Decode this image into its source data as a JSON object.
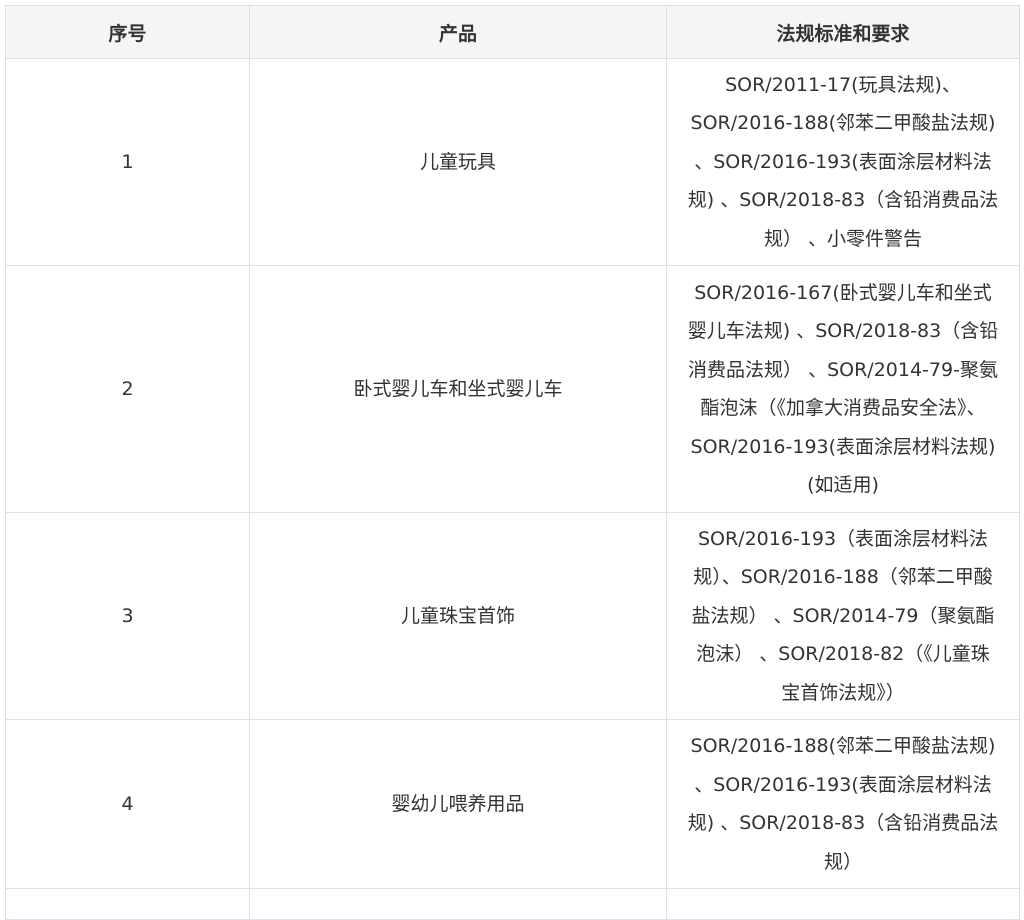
{
  "table": {
    "headers": [
      "序号",
      "产品",
      "法规标准和要求"
    ],
    "rows": [
      {
        "no": "1",
        "product": "儿童玩具",
        "requirements": "SOR/2011-17(玩具法规)、SOR/2016-188(邻苯二甲酸盐法规) 、SOR/2016-193(表面涂层材料法规) 、SOR/2018-83（含铅消费品法规） 、小零件警告"
      },
      {
        "no": "2",
        "product": "卧式婴儿车和坐式婴儿车",
        "requirements": "SOR/2016-167(卧式婴儿车和坐式婴儿车法规) 、SOR/2018-83（含铅消费品法规） 、SOR/2014-79-聚氨酯泡沫（《加拿大消费品安全法》、SOR/2016-193(表面涂层材料法规) (如适用)"
      },
      {
        "no": "3",
        "product": "儿童珠宝首饰",
        "requirements": "SOR/2016-193（表面涂层材料法规）、SOR/2016-188（邻苯二甲酸盐法规） 、SOR/2014-79（聚氨酯泡沫） 、SOR/2018-82（《儿童珠宝首饰法规》）"
      },
      {
        "no": "4",
        "product": "婴幼儿喂养用品",
        "requirements": "SOR/2016-188(邻苯二甲酸盐法规) 、SOR/2016-193(表面涂层材料法规) 、SOR/2018-83（含铅消费品法规）"
      }
    ]
  }
}
